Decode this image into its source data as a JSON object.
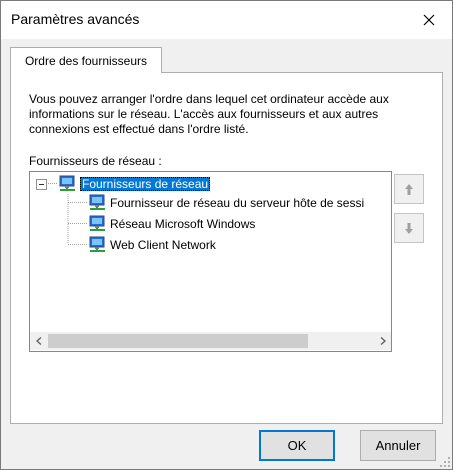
{
  "window": {
    "title": "Paramètres avancés"
  },
  "tabs": [
    {
      "label": "Ordre des fournisseurs"
    }
  ],
  "panel": {
    "description": "Vous pouvez arranger l'ordre dans lequel cet ordinateur accède aux informations sur le réseau. L'accès aux fournisseurs et aux autres connexions est effectué dans l'ordre listé.",
    "list_label": "Fournisseurs de réseau :"
  },
  "tree": {
    "root": {
      "label": "Fournisseurs de réseau",
      "icon": "network-icon",
      "expander": "−"
    },
    "children": [
      {
        "label": "Fournisseur de réseau du serveur hôte de sessi",
        "icon": "network-icon"
      },
      {
        "label": "Réseau Microsoft Windows",
        "icon": "network-icon"
      },
      {
        "label": "Web Client Network",
        "icon": "network-icon"
      }
    ]
  },
  "buttons": {
    "move_up_icon": "arrow-up-icon",
    "move_down_icon": "arrow-down-icon",
    "ok": "OK",
    "cancel": "Annuler"
  },
  "colors": {
    "selection": "#0078d7",
    "window_bg": "#f0f0f0",
    "panel_bg": "#ffffff"
  }
}
